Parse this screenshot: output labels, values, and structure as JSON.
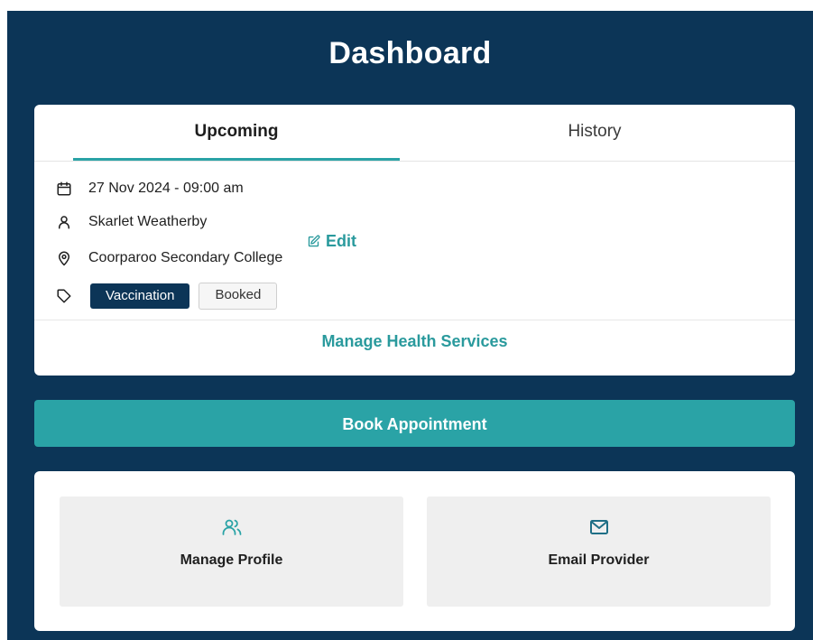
{
  "header": {
    "title": "Dashboard"
  },
  "tabs": [
    {
      "label": "Upcoming",
      "active": true
    },
    {
      "label": "History",
      "active": false
    }
  ],
  "appointment": {
    "datetime": "27 Nov 2024 - 09:00 am",
    "person": "Skarlet Weatherby",
    "location": "Coorparoo Secondary College",
    "service_tag": "Vaccination",
    "status_tag": "Booked",
    "edit_label": "Edit"
  },
  "manage_link": "Manage Health Services",
  "book_button": "Book Appointment",
  "actions": [
    {
      "label": "Manage Profile",
      "icon": "users-icon"
    },
    {
      "label": "Email Provider",
      "icon": "mail-icon"
    }
  ],
  "colors": {
    "navy": "#0c3557",
    "teal": "#2aa3a6",
    "teal_text": "#2a9a9d",
    "tile_bg": "#efefef"
  }
}
